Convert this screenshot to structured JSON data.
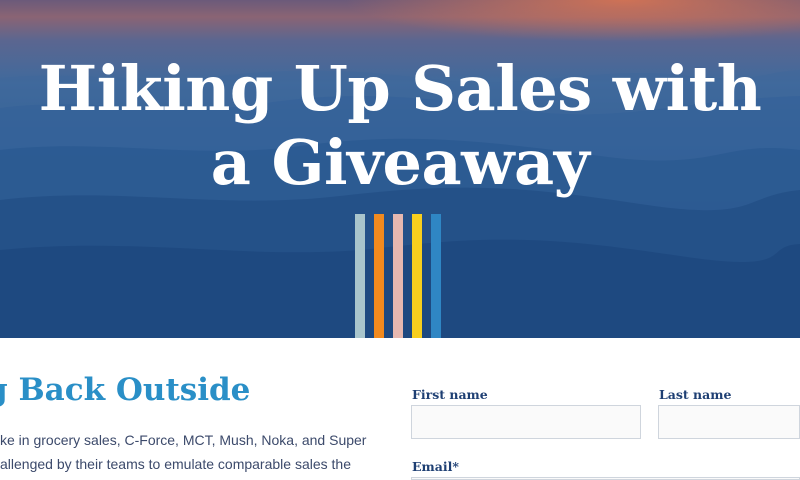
{
  "hero": {
    "title_line1": "Hiking Up Sales with",
    "title_line2": "a Giveaway",
    "stripe_colors": [
      "#a9c5cc",
      "#f28a1e",
      "#e6b8b0",
      "#f8cf1e",
      "#2f86c4"
    ]
  },
  "section": {
    "heading": "g Back Outside",
    "body_lines": [
      "ke in grocery sales, C-Force, MCT, Mush, Noka, and Super",
      "allenged by their teams to emulate comparable sales the"
    ]
  },
  "form": {
    "first_name_label": "First name",
    "last_name_label": "Last name",
    "email_label": "Email*",
    "first_name_value": "",
    "last_name_value": "",
    "email_value": ""
  },
  "colors": {
    "heading_accent": "#2a8fc7",
    "label_navy": "#1e3f73",
    "hero_blue": "#1d4a7f"
  }
}
